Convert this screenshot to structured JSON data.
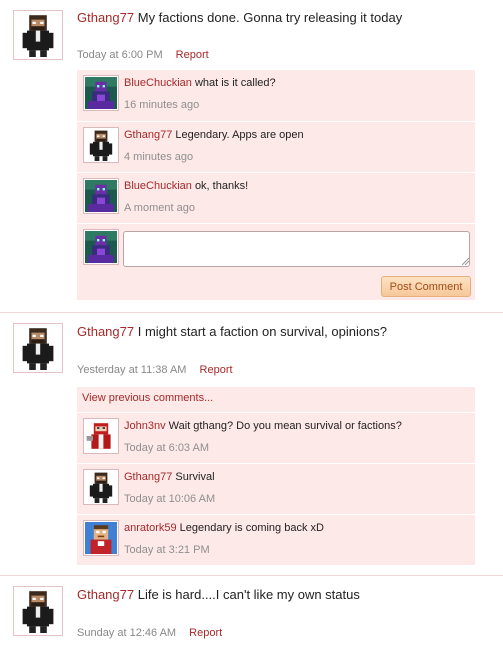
{
  "posts": [
    {
      "author": "Gthang77",
      "text": "My factions done. Gonna try releasing it today",
      "time": "Today at 6:00 PM",
      "report": "Report",
      "comments": [
        {
          "author": "BlueChuckian",
          "text": "what is it called?",
          "time": "16 minutes ago"
        },
        {
          "author": "Gthang77",
          "text": "Legendary. Apps are open",
          "time": "4 minutes ago"
        },
        {
          "author": "BlueChuckian",
          "text": "ok, thanks!",
          "time": "A moment ago"
        }
      ],
      "comment_box": {
        "value": "",
        "button": "Post Comment"
      }
    },
    {
      "author": "Gthang77",
      "text": "I might start a faction on survival, opinions?",
      "time": "Yesterday at 11:38 AM",
      "report": "Report",
      "view_previous": "View previous comments...",
      "comments": [
        {
          "author": "John3nv",
          "text": "Wait gthang? Do you mean survival or factions?",
          "time": "Today at 6:03 AM"
        },
        {
          "author": "Gthang77",
          "text": "Survival",
          "time": "Today at 10:06 AM"
        },
        {
          "author": "anratork59",
          "text": "Legendary is coming back xD",
          "time": "Today at 3:21 PM"
        }
      ]
    },
    {
      "author": "Gthang77",
      "text": "Life is hard....I can't like my own status",
      "time": "Sunday at 12:46 AM",
      "report": "Report"
    }
  ],
  "colors": {
    "accent": "#a52a2a",
    "comment_bg": "#fde9e8",
    "meta": "#888888"
  }
}
